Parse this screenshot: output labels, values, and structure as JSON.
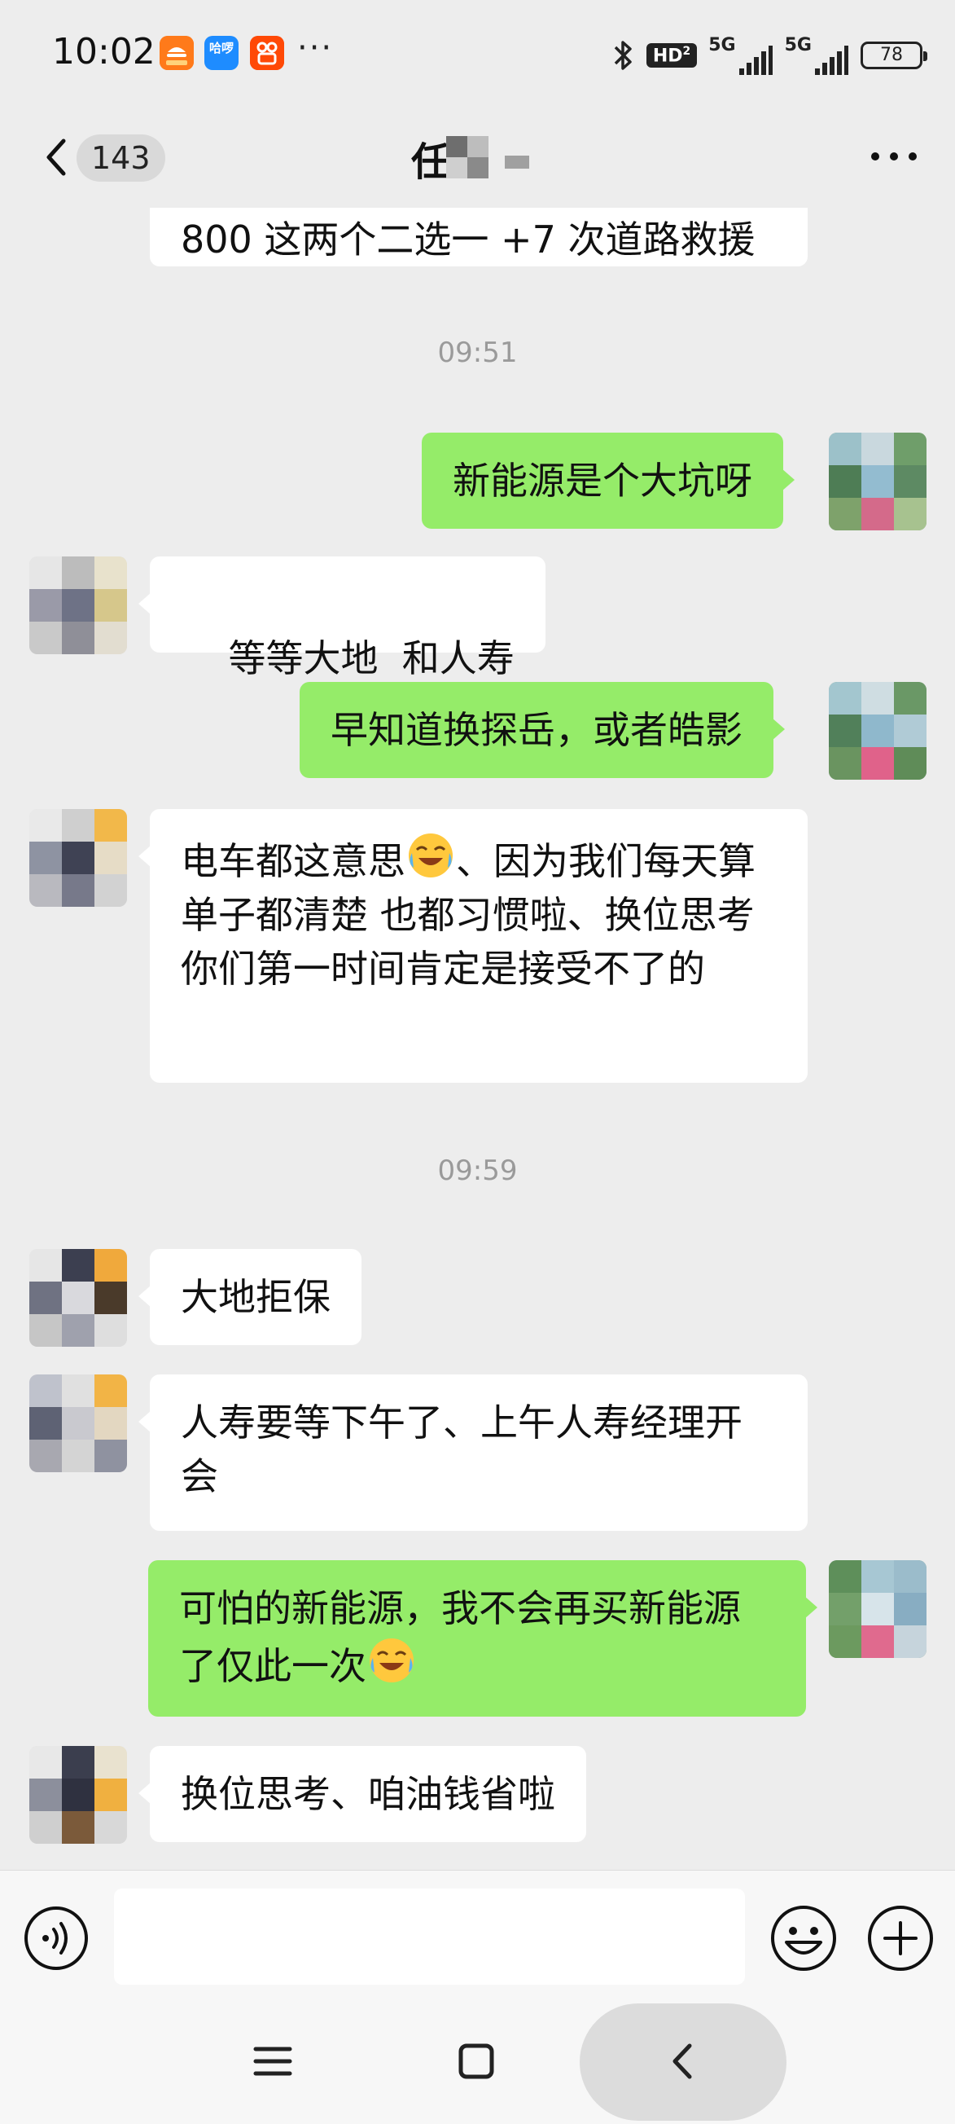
{
  "status_bar": {
    "time": "10:02",
    "apps": [
      {
        "name": "food-app-icon",
        "label": "",
        "color": "#ff6a00"
      },
      {
        "name": "hello-app-icon",
        "label": "哈啰",
        "color": "#1e8cff"
      },
      {
        "name": "kuaishou-app-icon",
        "label": "",
        "color": "#ff4906"
      }
    ],
    "more_indicator": "···",
    "hd_label": "HD",
    "hd_sub": "2",
    "signal_1_label": "5G",
    "signal_2_label": "5G",
    "battery": "78"
  },
  "header": {
    "unread_count": "143",
    "title": "任"
  },
  "messages": [
    {
      "side": "left",
      "text": "800 这两个二选一 +7 次道路救援"
    },
    {
      "type": "time",
      "text": "09:51"
    },
    {
      "side": "right",
      "text": "新能源是个大坑呀"
    },
    {
      "side": "left",
      "text": "等等大地  和人寿"
    },
    {
      "side": "right",
      "text": "早知道换探岳，或者皓影"
    },
    {
      "side": "left",
      "text": "电车都这意思",
      "emoji": "crying-laughing-emoji",
      "text2": "、因为我们每天算单子都清楚 也都习惯啦、换位思考你们第一时间肯定是接受不了的"
    },
    {
      "type": "time",
      "text": "09:59"
    },
    {
      "side": "left",
      "text": "大地拒保"
    },
    {
      "side": "left",
      "text": "人寿要等下午了、上午人寿经理开会"
    },
    {
      "side": "right",
      "text": "可怕的新能源，我不会再买新能源了仅此一次",
      "emoji": "crying-laughing-emoji"
    },
    {
      "side": "left",
      "text": "换位思考、咱油钱省啦"
    }
  ],
  "colors": {
    "background": "#ededed",
    "my_bubble": "#95ec69",
    "their_bubble": "#ffffff",
    "timestamp": "#9a9a9a"
  }
}
